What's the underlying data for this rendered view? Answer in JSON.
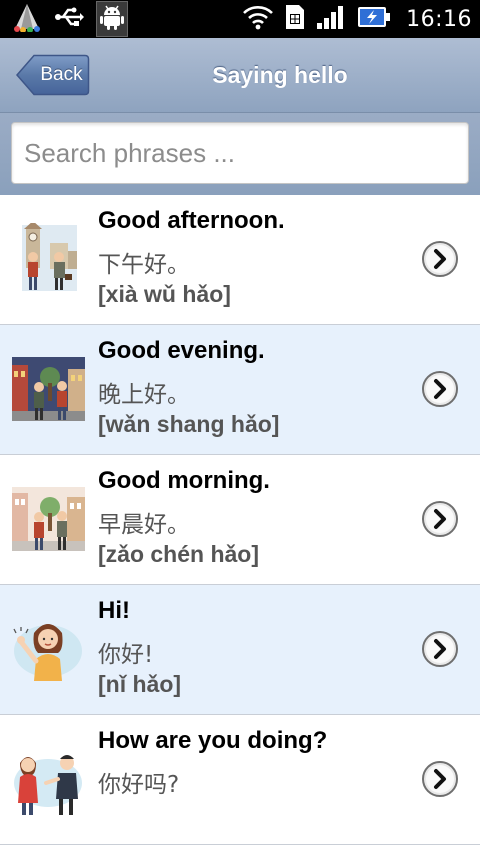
{
  "status_bar": {
    "time": "16:16",
    "left_icons": [
      "app-launcher-icon",
      "usb-icon",
      "android-debug-icon"
    ],
    "right_icons": [
      "wifi-icon",
      "sim-card-icon",
      "signal-icon",
      "battery-charging-icon"
    ]
  },
  "header": {
    "back_label": "Back",
    "title": "Saying hello"
  },
  "search": {
    "placeholder": "Search phrases ..."
  },
  "phrases": [
    {
      "english": "Good afternoon.",
      "chinese": "下午好。",
      "pinyin": "[xià wǔ hǎo]",
      "image": "two-men-meeting-clocktower-illustration",
      "action_icon": "chevron-right-icon"
    },
    {
      "english": "Good evening.",
      "chinese": "晚上好。",
      "pinyin": "[wǎn shang hǎo]",
      "image": "two-men-meeting-evening-street-illustration",
      "action_icon": "chevron-right-icon"
    },
    {
      "english": "Good morning.",
      "chinese": "早晨好。",
      "pinyin": "[zǎo chén hǎo]",
      "image": "two-men-meeting-morning-street-illustration",
      "action_icon": "chevron-right-icon"
    },
    {
      "english": "Hi!",
      "chinese": "你好!",
      "pinyin": "[nǐ hǎo]",
      "image": "woman-waving-illustration",
      "action_icon": "chevron-right-icon"
    },
    {
      "english": "How are you doing?",
      "chinese": "你好吗?",
      "pinyin": "",
      "image": "woman-and-man-talking-illustration",
      "action_icon": "chevron-right-icon"
    }
  ],
  "colors": {
    "header_gradient_top": "#aebdd3",
    "header_gradient_bottom": "#8ea3bf",
    "back_button": "#5a79a8",
    "alt_row_background": "#e7f1fc",
    "pinyin_text": "#555555"
  }
}
